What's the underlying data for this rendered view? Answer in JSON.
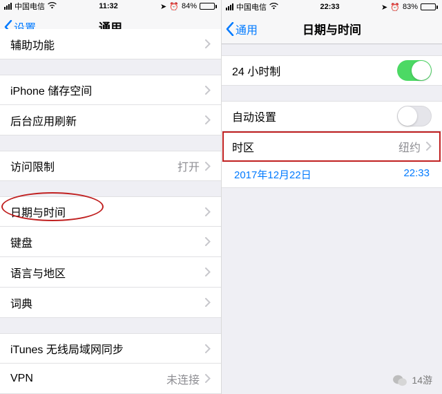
{
  "left": {
    "status": {
      "carrier": "中国电信",
      "time": "11:32",
      "battery_pct": "84%",
      "battery_fill": 84
    },
    "nav": {
      "back": "设置",
      "title": "通用"
    },
    "rows": {
      "accessibility": "辅助功能",
      "storage": "iPhone 储存空间",
      "bg_refresh": "后台应用刷新",
      "restrictions": "访问限制",
      "restrictions_val": "打开",
      "date_time": "日期与时间",
      "keyboard": "键盘",
      "lang_region": "语言与地区",
      "dictionary": "词典",
      "itunes_wifi": "iTunes 无线局域网同步",
      "vpn": "VPN",
      "vpn_val": "未连接"
    }
  },
  "right": {
    "status": {
      "carrier": "中国电信",
      "time": "22:33",
      "battery_pct": "83%",
      "battery_fill": 83
    },
    "nav": {
      "back": "通用",
      "title": "日期与时间"
    },
    "rows": {
      "h24": "24 小时制",
      "auto": "自动设置",
      "timezone": "时区",
      "timezone_val": "纽约",
      "date": "2017年12月22日",
      "time": "22:33"
    }
  },
  "watermark": "14游"
}
